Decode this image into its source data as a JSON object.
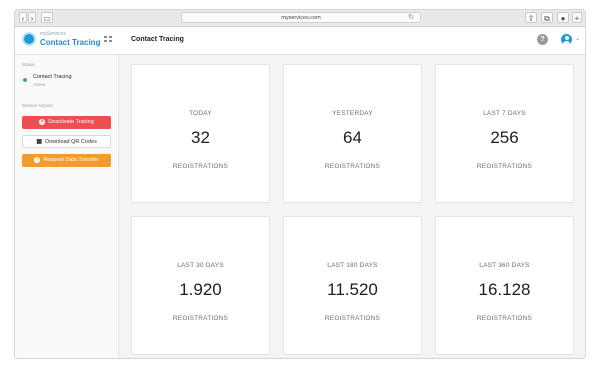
{
  "browser": {
    "url": "myservices.com"
  },
  "app": {
    "brand_small": "myServices",
    "brand_title": "Contact Tracing",
    "page_title": "Contact Tracing",
    "help_glyph": "?"
  },
  "sidebar": {
    "status_heading": "Status",
    "status_name": "Contact Tracing",
    "status_sub": "Active",
    "actions_heading": "Service Actions",
    "actions": [
      {
        "label": "Deactivate Tracing",
        "icon": "stop-icon"
      },
      {
        "label": "Download QR Codes",
        "icon": "qr-code-icon"
      },
      {
        "label": "Request Data Transfer",
        "icon": "info-icon"
      }
    ]
  },
  "colors": {
    "accent": "#1d9ad6",
    "danger": "#ef4e51",
    "warning": "#f39c2c",
    "status_active": "#3cb44b"
  },
  "stats": [
    {
      "period": "TODAY",
      "value": "32",
      "unit": "REGISTRATIONS"
    },
    {
      "period": "YESTERDAY",
      "value": "64",
      "unit": "REGISTRATIONS"
    },
    {
      "period": "LAST 7 DAYS",
      "value": "256",
      "unit": "REGISTRATIONS"
    },
    {
      "period": "LAST 30 DAYS",
      "value": "1.920",
      "unit": "REGISTRATIONS"
    },
    {
      "period": "LAST 180 DAYS",
      "value": "11.520",
      "unit": "REGISTRATIONS"
    },
    {
      "period": "LAST 360 DAYS",
      "value": "16.128",
      "unit": "REGISTRATIONS"
    }
  ]
}
